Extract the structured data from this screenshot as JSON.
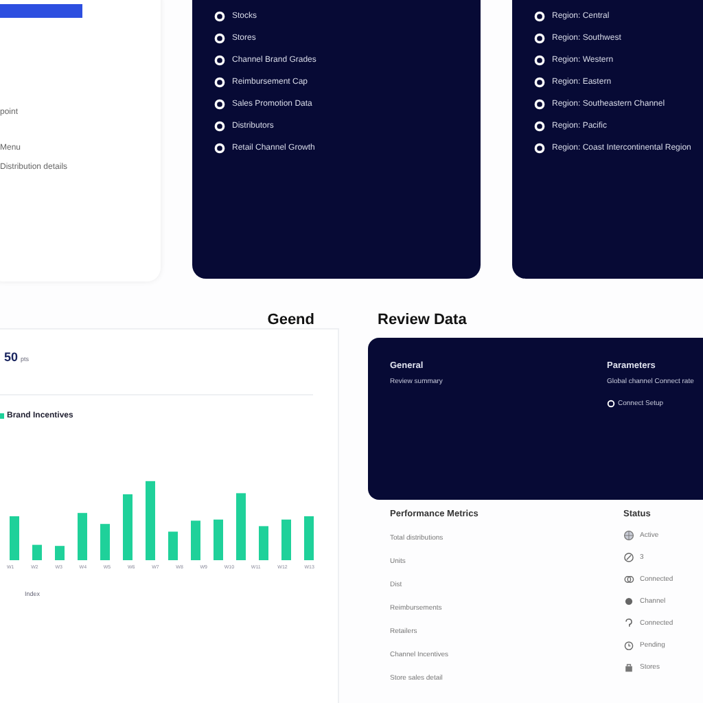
{
  "summary_card": {
    "lines": [
      "point",
      "Menu",
      "Distribution details"
    ]
  },
  "channels_card": {
    "items": [
      "Stocks",
      "Stores",
      "Channel Brand Grades",
      "Reimbursement Cap",
      "Sales Promotion Data",
      "Distributors",
      "Retail Channel Growth"
    ]
  },
  "regions_card": {
    "items": [
      "Region: Central",
      "Region: Southwest",
      "Region: Western",
      "Region: Eastern",
      "Region: Southeastern Channel",
      "Region: Pacific",
      "Region: Coast Intercontinental Region"
    ]
  },
  "chart_heading": "Geend",
  "chart_panel": {
    "value": "50",
    "unit": "pts",
    "legend": "Brand Incentives",
    "axis_labels": [
      "W1",
      "W2",
      "W3",
      "W4",
      "W5",
      "W6",
      "W7",
      "W8",
      "W9",
      "W10",
      "W11",
      "W12",
      "W13"
    ],
    "note": "Index"
  },
  "review": {
    "title": "Review Data",
    "general": {
      "title": "General",
      "text": "Review summary"
    },
    "parameters": {
      "title": "Parameters",
      "text": "Global channel Connect rate",
      "option": "Connect Setup"
    },
    "metrics": {
      "title": "Performance Metrics",
      "items": [
        "Total distributions",
        "Units",
        "Dist",
        "Reimbursements",
        "Retailers",
        "Channel Incentives",
        "Store sales detail"
      ]
    },
    "status": {
      "title": "Status",
      "items": [
        {
          "kind": "globe",
          "label": "Active"
        },
        {
          "kind": "slash",
          "label": "3"
        },
        {
          "kind": "link",
          "label": "Connected"
        },
        {
          "kind": "dot",
          "label": "Channel"
        },
        {
          "kind": "hook",
          "label": "Connected"
        },
        {
          "kind": "clock",
          "label": "Pending"
        },
        {
          "kind": "bag",
          "label": "Stores"
        }
      ]
    }
  }
}
